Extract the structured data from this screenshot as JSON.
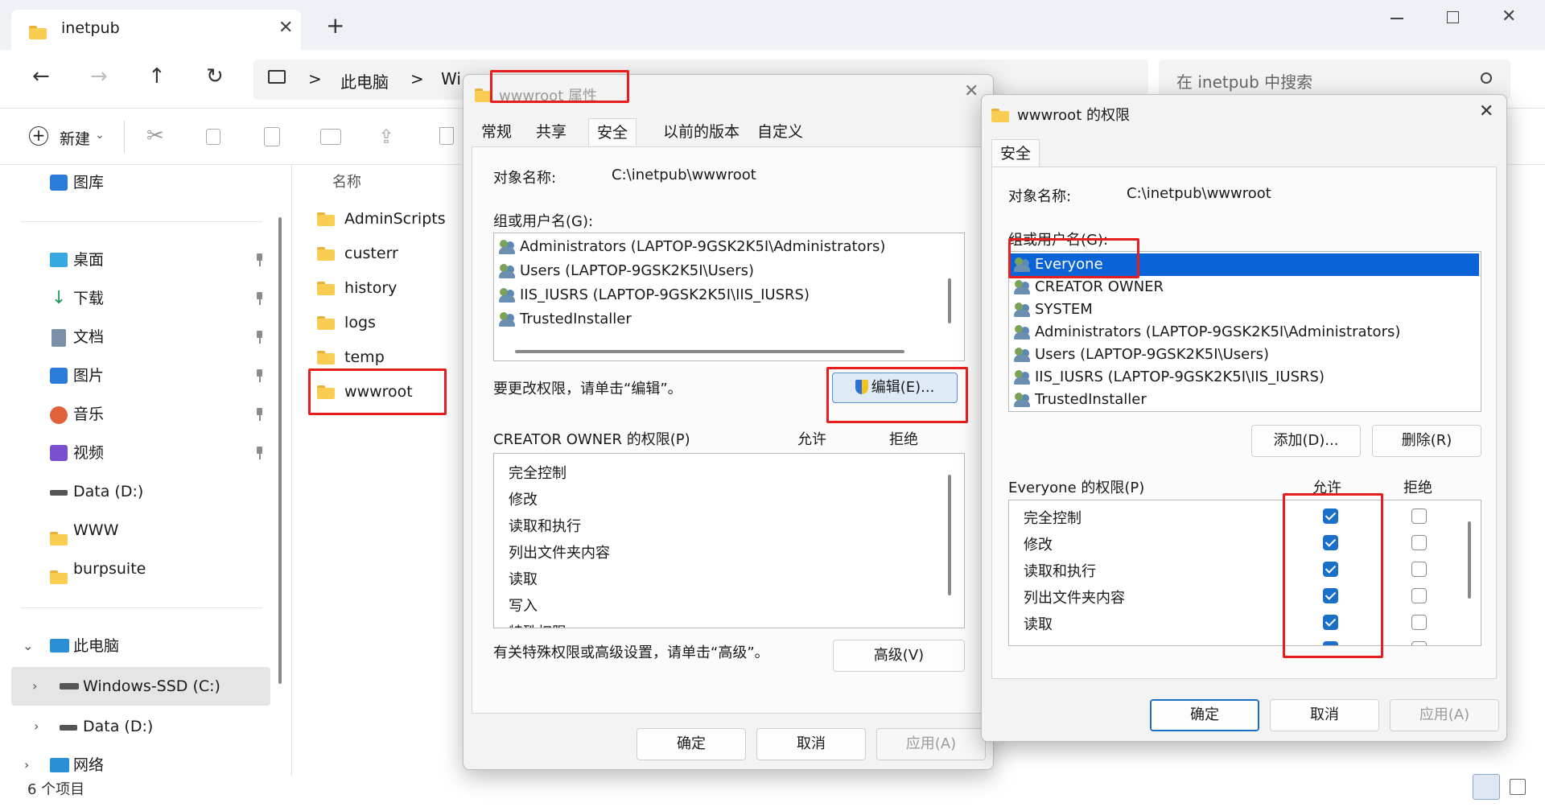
{
  "explorer": {
    "tab_title": "inetpub",
    "new_tab_plus": "+",
    "breadcrumb_pc": "此电脑",
    "breadcrumb_sep": ">",
    "breadcrumb_drive_partial": "Wi",
    "search_placeholder": "在 inetpub 中搜索",
    "new_label": "新建",
    "column_name": "名称",
    "status_items": "6 个项目",
    "sidebar": {
      "gallery": "图库",
      "desktop": "桌面",
      "downloads": "下载",
      "documents": "文档",
      "pictures": "图片",
      "music": "音乐",
      "videos": "视频",
      "data_d": "Data (D:)",
      "www": "WWW",
      "burpsuite": "burpsuite",
      "this_pc": "此电脑",
      "windows_ssd": "Windows-SSD (C:)",
      "data_d2": "Data (D:)",
      "network": "网络"
    },
    "files": [
      "AdminScripts",
      "custerr",
      "history",
      "logs",
      "temp",
      "wwwroot"
    ]
  },
  "props": {
    "title": "wwwroot 属性",
    "tabs": [
      "常规",
      "共享",
      "安全",
      "以前的版本",
      "自定义"
    ],
    "object_label": "对象名称:",
    "object_value": "C:\\inetpub\\wwwroot",
    "group_label": "组或用户名(G):",
    "users": [
      "Administrators (LAPTOP-9GSK2K5I\\Administrators)",
      "Users (LAPTOP-9GSK2K5I\\Users)",
      "IIS_IUSRS (LAPTOP-9GSK2K5I\\IIS_IUSRS)",
      "TrustedInstaller"
    ],
    "edit_hint": "要更改权限，请单击“编辑”。",
    "edit_button": "编辑(E)...",
    "perm_label": "CREATOR OWNER 的权限(P)",
    "allow": "允许",
    "deny": "拒绝",
    "perms": [
      "完全控制",
      "修改",
      "读取和执行",
      "列出文件夹内容",
      "读取",
      "写入",
      "特殊权限"
    ],
    "advanced_hint": "有关特殊权限或高级设置，请单击“高级”。",
    "advanced_button": "高级(V)",
    "ok": "确定",
    "cancel": "取消",
    "apply": "应用(A)"
  },
  "perm_dialog": {
    "title": "wwwroot 的权限",
    "tab": "安全",
    "object_label": "对象名称:",
    "object_value": "C:\\inetpub\\wwwroot",
    "group_label": "组或用户名(G):",
    "users": [
      "Everyone",
      "CREATOR OWNER",
      "SYSTEM",
      "Administrators (LAPTOP-9GSK2K5I\\Administrators)",
      "Users (LAPTOP-9GSK2K5I\\Users)",
      "IIS_IUSRS (LAPTOP-9GSK2K5I\\IIS_IUSRS)",
      "TrustedInstaller"
    ],
    "add_button": "添加(D)...",
    "remove_button": "删除(R)",
    "perm_label": "Everyone 的权限(P)",
    "allow": "允许",
    "deny": "拒绝",
    "perms": [
      {
        "name": "完全控制",
        "allow": true,
        "deny": false
      },
      {
        "name": "修改",
        "allow": true,
        "deny": false
      },
      {
        "name": "读取和执行",
        "allow": true,
        "deny": false
      },
      {
        "name": "列出文件夹内容",
        "allow": true,
        "deny": false
      },
      {
        "name": "读取",
        "allow": true,
        "deny": false
      }
    ],
    "ok": "确定",
    "cancel": "取消",
    "apply": "应用(A)"
  },
  "colors": {
    "accent": "#1a6fc9",
    "highlight_box": "#e81e1e",
    "selected_row": "#0a64d8"
  }
}
